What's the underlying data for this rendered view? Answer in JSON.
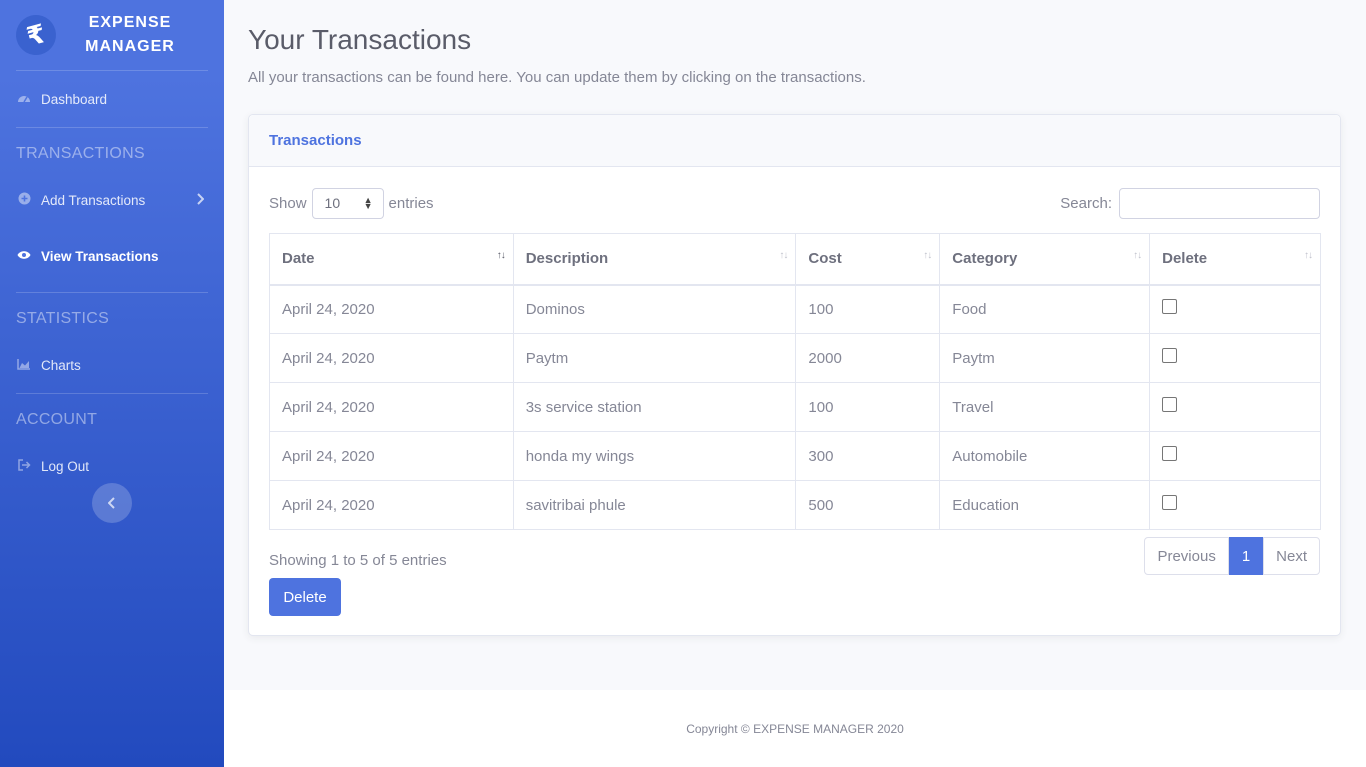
{
  "brand": {
    "logo": "₹",
    "title_line1": "EXPENSE",
    "title_line2": "MANAGER"
  },
  "sidebar": {
    "dashboard": "Dashboard",
    "heading_transactions": "TRANSACTIONS",
    "add_transactions": "Add Transactions",
    "view_transactions": "View Transactions",
    "heading_statistics": "STATISTICS",
    "charts": "Charts",
    "heading_account": "ACCOUNT",
    "logout": "Log Out"
  },
  "page": {
    "title": "Your Transactions",
    "subtitle": "All your transactions can be found here. You can update them by clicking on the transactions."
  },
  "card": {
    "title": "Transactions",
    "show_label": "Show",
    "entries_value": "10",
    "entries_label": "entries",
    "search_label": "Search:",
    "search_value": ""
  },
  "table": {
    "headers": [
      "Date",
      "Description",
      "Cost",
      "Category",
      "Delete"
    ],
    "rows": [
      [
        "April 24, 2020",
        "Dominos",
        "100",
        "Food"
      ],
      [
        "April 24, 2020",
        "Paytm",
        "2000",
        "Paytm"
      ],
      [
        "April 24, 2020",
        "3s service station",
        "100",
        "Travel"
      ],
      [
        "April 24, 2020",
        "honda my wings",
        "300",
        "Automobile"
      ],
      [
        "April 24, 2020",
        "savitribai phule",
        "500",
        "Education"
      ]
    ]
  },
  "pagination": {
    "info": "Showing 1 to 5 of 5 entries",
    "previous": "Previous",
    "current": "1",
    "next": "Next"
  },
  "delete_button": "Delete",
  "footer": "Copyright © EXPENSE MANAGER 2020",
  "colors": {
    "primary": "#4e73df",
    "sidebar_end": "#224abe"
  },
  "icons": [
    "rupee-icon",
    "dashboard-icon",
    "plus-circle-icon",
    "chevron-right-icon",
    "eye-icon",
    "chart-area-icon",
    "sign-out-icon",
    "chevron-left-icon",
    "sort-icon"
  ]
}
